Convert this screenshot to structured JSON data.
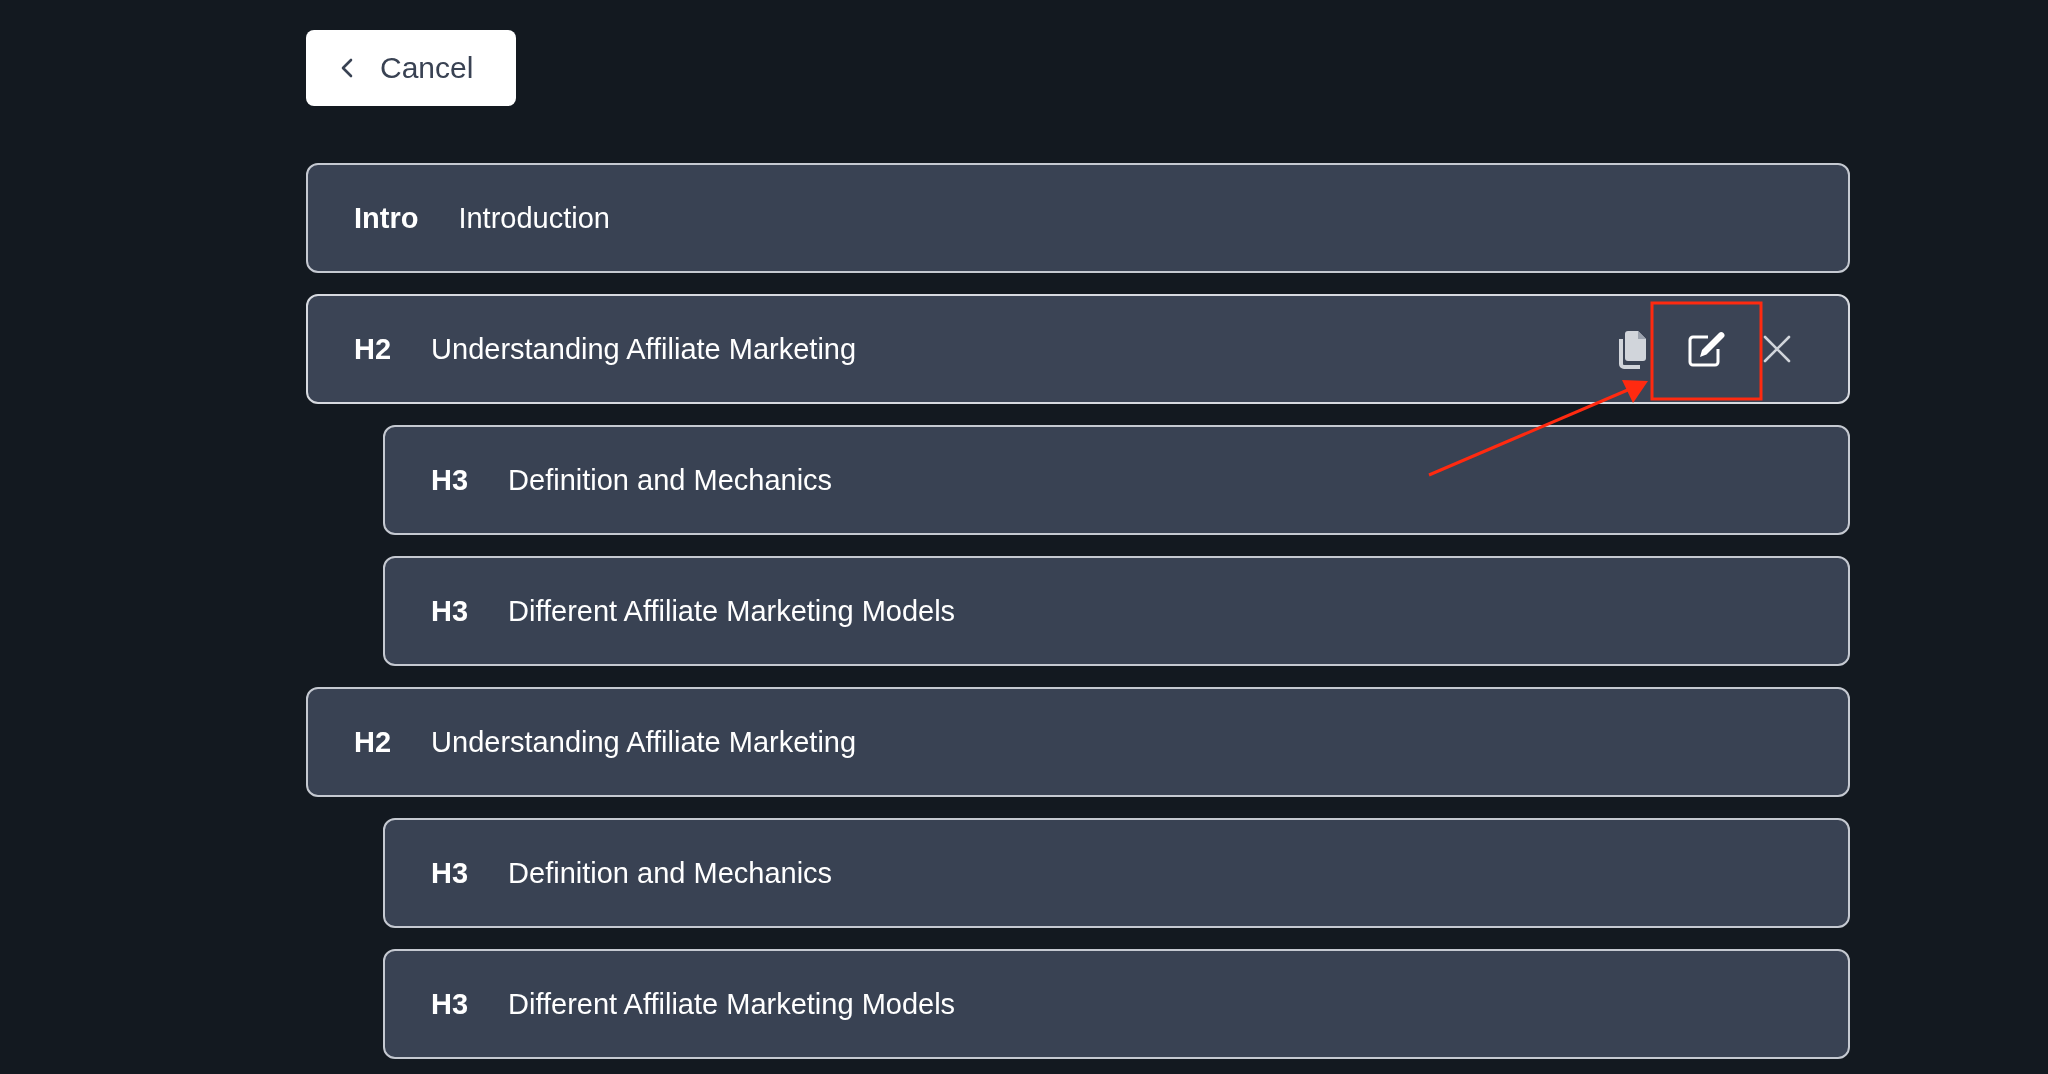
{
  "cancel_button": {
    "label": "Cancel"
  },
  "outline": [
    {
      "tag": "Intro",
      "title": "Introduction",
      "hovered": false
    },
    {
      "tag": "H2",
      "title": "Understanding Affiliate Marketing",
      "hovered": true,
      "children": [
        {
          "tag": "H3",
          "title": "Definition and Mechanics",
          "hovered": false
        },
        {
          "tag": "H3",
          "title": "Different Affiliate Marketing Models",
          "hovered": false
        }
      ]
    },
    {
      "tag": "H2",
      "title": "Understanding Affiliate Marketing",
      "hovered": false,
      "children": [
        {
          "tag": "H3",
          "title": "Definition and Mechanics",
          "hovered": false
        },
        {
          "tag": "H3",
          "title": "Different Affiliate Marketing Models",
          "hovered": false
        }
      ]
    }
  ]
}
